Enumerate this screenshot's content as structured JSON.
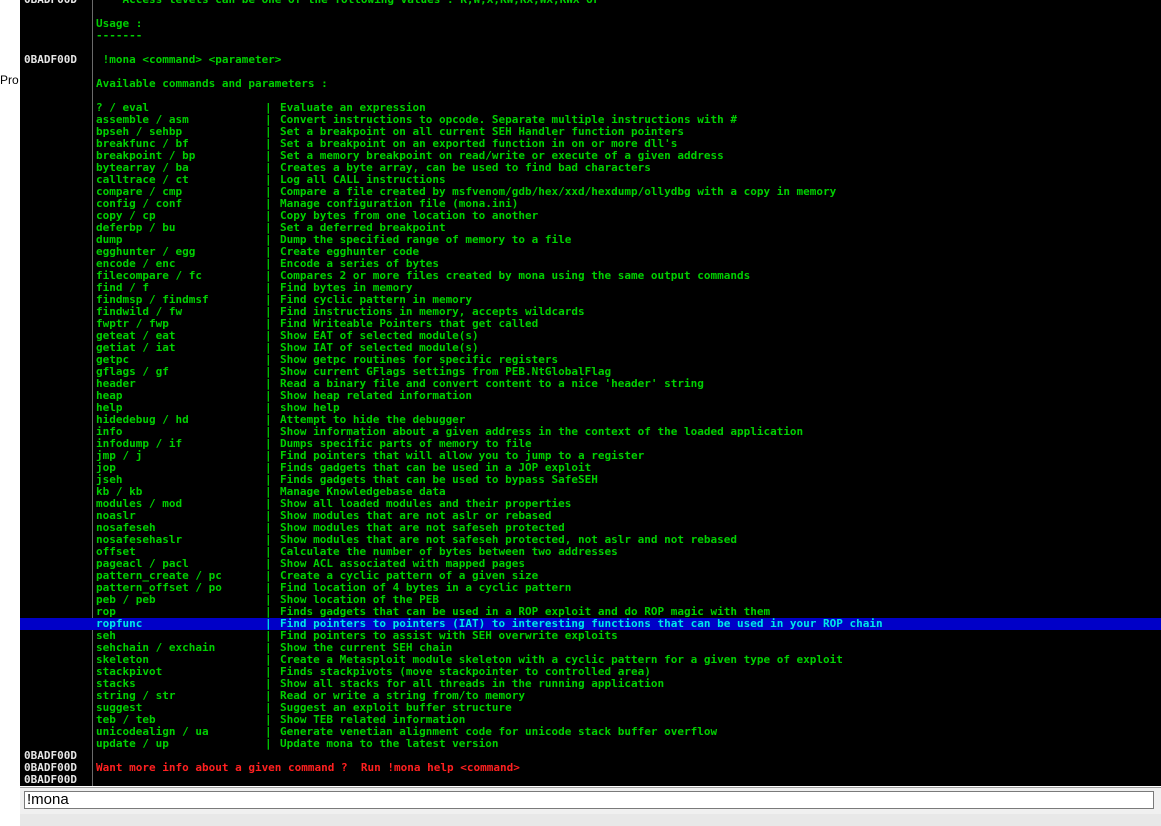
{
  "side_label": "Pro",
  "address": "0BADF00D",
  "header_lines": [
    "    Access levels can be one of the following values : R,W,X,RW,RX,WX,RWX or *",
    "Usage :",
    "-------"
  ],
  "usage_line": " !mona <command> <parameter>",
  "available_line": "Available commands and parameters :",
  "commands": [
    {
      "name": "? / eval",
      "desc": "Evaluate an expression"
    },
    {
      "name": "assemble / asm",
      "desc": "Convert instructions to opcode. Separate multiple instructions with #"
    },
    {
      "name": "bpseh / sehbp",
      "desc": "Set a breakpoint on all current SEH Handler function pointers"
    },
    {
      "name": "breakfunc / bf",
      "desc": "Set a breakpoint on an exported function in on or more dll's"
    },
    {
      "name": "breakpoint / bp",
      "desc": "Set a memory breakpoint on read/write or execute of a given address"
    },
    {
      "name": "bytearray / ba",
      "desc": "Creates a byte array, can be used to find bad characters"
    },
    {
      "name": "calltrace / ct",
      "desc": "Log all CALL instructions"
    },
    {
      "name": "compare / cmp",
      "desc": "Compare a file created by msfvenom/gdb/hex/xxd/hexdump/ollydbg with a copy in memory"
    },
    {
      "name": "config / conf",
      "desc": "Manage configuration file (mona.ini)"
    },
    {
      "name": "copy / cp",
      "desc": "Copy bytes from one location to another"
    },
    {
      "name": "deferbp / bu",
      "desc": "Set a deferred breakpoint"
    },
    {
      "name": "dump",
      "desc": "Dump the specified range of memory to a file"
    },
    {
      "name": "egghunter / egg",
      "desc": "Create egghunter code"
    },
    {
      "name": "encode / enc",
      "desc": "Encode a series of bytes"
    },
    {
      "name": "filecompare / fc",
      "desc": "Compares 2 or more files created by mona using the same output commands"
    },
    {
      "name": "find / f",
      "desc": "Find bytes in memory"
    },
    {
      "name": "findmsp / findmsf",
      "desc": "Find cyclic pattern in memory"
    },
    {
      "name": "findwild / fw",
      "desc": "Find instructions in memory, accepts wildcards"
    },
    {
      "name": "fwptr / fwp",
      "desc": "Find Writeable Pointers that get called"
    },
    {
      "name": "geteat / eat",
      "desc": "Show EAT of selected module(s)"
    },
    {
      "name": "getiat / iat",
      "desc": "Show IAT of selected module(s)"
    },
    {
      "name": "getpc",
      "desc": "Show getpc routines for specific registers"
    },
    {
      "name": "gflags / gf",
      "desc": "Show current GFlags settings from PEB.NtGlobalFlag"
    },
    {
      "name": "header",
      "desc": "Read a binary file and convert content to a nice 'header' string"
    },
    {
      "name": "heap",
      "desc": "Show heap related information"
    },
    {
      "name": "help",
      "desc": "show help"
    },
    {
      "name": "hidedebug / hd",
      "desc": "Attempt to hide the debugger"
    },
    {
      "name": "info",
      "desc": "Show information about a given address in the context of the loaded application"
    },
    {
      "name": "infodump / if",
      "desc": "Dumps specific parts of memory to file"
    },
    {
      "name": "jmp / j",
      "desc": "Find pointers that will allow you to jump to a register"
    },
    {
      "name": "jop",
      "desc": "Finds gadgets that can be used in a JOP exploit"
    },
    {
      "name": "jseh",
      "desc": "Finds gadgets that can be used to bypass SafeSEH"
    },
    {
      "name": "kb / kb",
      "desc": "Manage Knowledgebase data"
    },
    {
      "name": "modules / mod",
      "desc": "Show all loaded modules and their properties"
    },
    {
      "name": "noaslr",
      "desc": "Show modules that are not aslr or rebased"
    },
    {
      "name": "nosafeseh",
      "desc": "Show modules that are not safeseh protected"
    },
    {
      "name": "nosafesehaslr",
      "desc": "Show modules that are not safeseh protected, not aslr and not rebased"
    },
    {
      "name": "offset",
      "desc": "Calculate the number of bytes between two addresses"
    },
    {
      "name": "pageacl / pacl",
      "desc": "Show ACL associated with mapped pages"
    },
    {
      "name": "pattern_create / pc",
      "desc": "Create a cyclic pattern of a given size"
    },
    {
      "name": "pattern_offset / po",
      "desc": "Find location of 4 bytes in a cyclic pattern"
    },
    {
      "name": "peb / peb",
      "desc": "Show location of the PEB"
    },
    {
      "name": "rop",
      "desc": "Finds gadgets that can be used in a ROP exploit and do ROP magic with them"
    },
    {
      "name": "ropfunc",
      "desc": "Find pointers to pointers (IAT) to interesting functions that can be used in your ROP chain",
      "selected": true
    },
    {
      "name": "seh",
      "desc": "Find pointers to assist with SEH overwrite exploits"
    },
    {
      "name": "sehchain / exchain",
      "desc": "Show the current SEH chain"
    },
    {
      "name": "skeleton",
      "desc": "Create a Metasploit module skeleton with a cyclic pattern for a given type of exploit"
    },
    {
      "name": "stackpivot",
      "desc": "Finds stackpivots (move stackpointer to controlled area)"
    },
    {
      "name": "stacks",
      "desc": "Show all stacks for all threads in the running application"
    },
    {
      "name": "string / str",
      "desc": "Read or write a string from/to memory"
    },
    {
      "name": "suggest",
      "desc": "Suggest an exploit buffer structure"
    },
    {
      "name": "teb / teb",
      "desc": "Show TEB related information"
    },
    {
      "name": "unicodealign / ua",
      "desc": "Generate venetian alignment code for unicode stack buffer overflow"
    },
    {
      "name": "update / up",
      "desc": "Update mona to the latest version"
    }
  ],
  "cmd_separator": "|",
  "footer_line": "Want more info about a given command ?  Run !mona help <command>",
  "command_input": {
    "value": "!mona"
  },
  "colors": {
    "background": "#000000",
    "text_green": "#00d000",
    "address": "#e6e6e6",
    "highlight": "#0000c8",
    "footer_red": "#ff2020"
  }
}
